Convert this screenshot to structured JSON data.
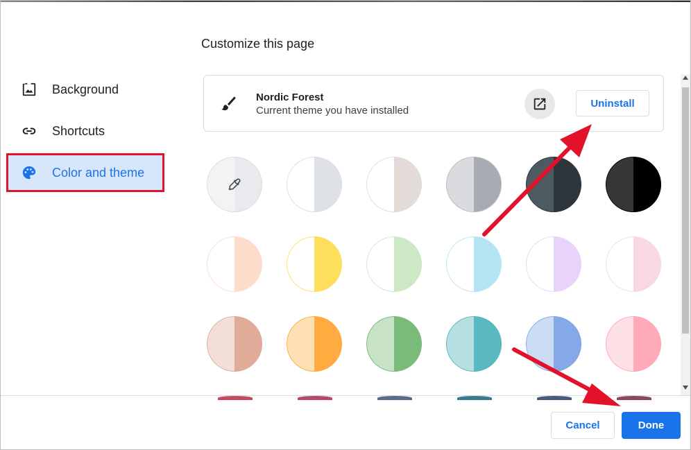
{
  "page": {
    "title": "Customize this page"
  },
  "sidebar": {
    "items": [
      {
        "label": "Background",
        "icon": "image-icon"
      },
      {
        "label": "Shortcuts",
        "icon": "link-icon"
      },
      {
        "label": "Color and theme",
        "icon": "palette-icon",
        "active": true
      }
    ]
  },
  "theme": {
    "name": "Nordic Forest",
    "subtitle": "Current theme you have installed",
    "uninstall_label": "Uninstall",
    "icon": "paintbrush-icon",
    "open_icon": "open-in-new-icon"
  },
  "colors": {
    "accent": "#1a73e8",
    "highlight": "#e3122b",
    "swatches": [
      [
        {
          "left": "#f1f3f4",
          "right": "#f1f3f4",
          "border": "#dadce0",
          "custom": true
        },
        {
          "left": "#ffffff",
          "right": "#dee1e6",
          "border": "#dadce0"
        },
        {
          "left": "#ffffff",
          "right": "#e3dbd8",
          "border": "#dadce0"
        },
        {
          "left": "#dadbdf",
          "right": "#a8abb4",
          "border": "#bdbdbd"
        },
        {
          "left": "#4d5a62",
          "right": "#2f363b",
          "border": "#2f363b"
        },
        {
          "left": "#373737",
          "right": "#000000",
          "border": "#000000"
        }
      ],
      [
        {
          "left": "#ffffff",
          "right": "#fcdcca",
          "border": "#fcdcca"
        },
        {
          "left": "#ffffff",
          "right": "#fedf5d",
          "border": "#fedf5d"
        },
        {
          "left": "#ffffff",
          "right": "#cce8c4",
          "border": "#cce8c4"
        },
        {
          "left": "#ffffff",
          "right": "#b5e5f2",
          "border": "#b5e5f2"
        },
        {
          "left": "#ffffff",
          "right": "#e8d4fb",
          "border": "#e8d4fb"
        },
        {
          "left": "#ffffff",
          "right": "#f8d8e4",
          "border": "#f8d8e4"
        }
      ],
      [
        {
          "left": "#f3dfd8",
          "right": "#e0ab99",
          "border": "#e0ab99"
        },
        {
          "left": "#ffe0b5",
          "right": "#ffab40",
          "border": "#ffab40"
        },
        {
          "left": "#c7e2c4",
          "right": "#7abb79",
          "border": "#7abb79"
        },
        {
          "left": "#b7dfe2",
          "right": "#5ab8bf",
          "border": "#5ab8bf"
        },
        {
          "left": "#cbdcf4",
          "right": "#84a9e6",
          "border": "#84a9e6"
        },
        {
          "left": "#fde0e6",
          "right": "#ffaab7",
          "border": "#ffaab7"
        }
      ]
    ]
  },
  "footer": {
    "cancel_label": "Cancel",
    "done_label": "Done"
  }
}
